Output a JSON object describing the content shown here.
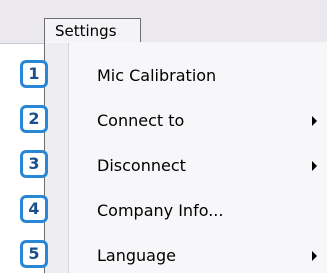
{
  "menu": {
    "title": "Settings",
    "items": [
      {
        "label": "Mic Calibration",
        "has_submenu": false
      },
      {
        "label": "Connect to",
        "has_submenu": true
      },
      {
        "label": "Disconnect",
        "has_submenu": true
      },
      {
        "label": "Company Info...",
        "has_submenu": false
      },
      {
        "label": "Language",
        "has_submenu": true
      }
    ]
  },
  "callouts": [
    "1",
    "2",
    "3",
    "4",
    "5"
  ],
  "colors": {
    "callout_border": "#2a86d6",
    "callout_text": "#1b4f8a",
    "menu_border": "#6f6f6f"
  }
}
